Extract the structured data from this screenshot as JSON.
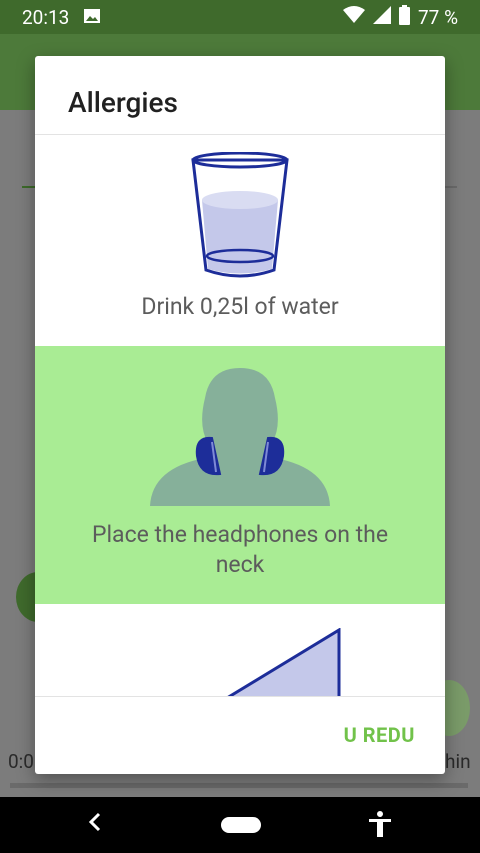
{
  "status_bar": {
    "time": "20:13",
    "battery": "77 %",
    "icons": [
      "image-icon",
      "wifi-icon",
      "signal-icon",
      "battery-icon"
    ]
  },
  "background": {
    "left_text": "0:0",
    "right_text": "hin"
  },
  "dialog": {
    "title": "Allergies",
    "steps": [
      {
        "label": "Drink 0,25l of water",
        "icon": "water-glass-icon",
        "active": false
      },
      {
        "label_line1": "Place the headphones on the",
        "label_line2": "neck",
        "icon": "headphones-on-neck-icon",
        "active": true
      },
      {
        "label": "",
        "icon": "triangle-icon",
        "active": false
      }
    ],
    "ok_label": "U REDU"
  },
  "colors": {
    "status_bar": "#3f6a2c",
    "active_step": "#a9ec94",
    "accent": "#71c24a",
    "illustration_blue": "#1d2d99",
    "illustration_fill": "#c4c8ea"
  }
}
